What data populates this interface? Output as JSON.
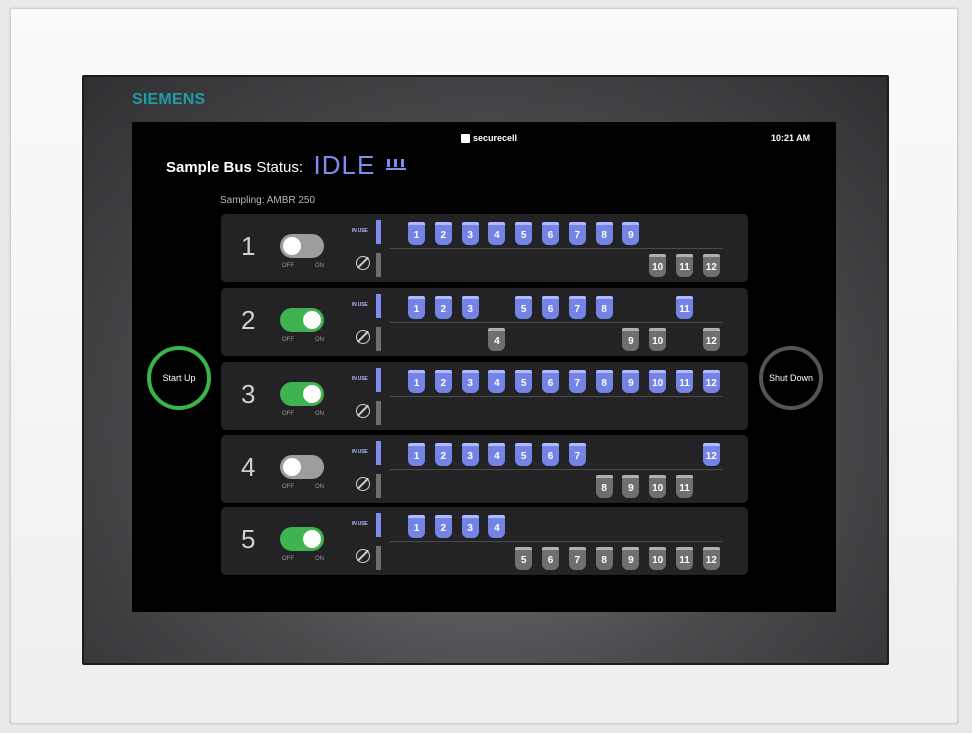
{
  "brand": "SIEMENS",
  "header": {
    "title_bold": "Sample Bus",
    "title_rest": "Status:",
    "status": "IDLE",
    "logo": "securecell",
    "time": "10:21 AM",
    "sampling": "Sampling: AMBR 250"
  },
  "buttons": {
    "start": "Start Up",
    "stop": "Shut Down"
  },
  "labels": {
    "in_use": "IN USE",
    "off": "OFF",
    "on": "ON"
  },
  "colors": {
    "in_use": "#7384e6",
    "idle": "#6f6f71",
    "toggle_on": "#3fb34f",
    "toggle_off": "#9d9d9f",
    "start_ring": "#38b449"
  },
  "rows": [
    {
      "number": "1",
      "on": false,
      "in_use": [
        1,
        2,
        3,
        4,
        5,
        6,
        7,
        8,
        9
      ],
      "idle": [
        10,
        11,
        12
      ]
    },
    {
      "number": "2",
      "on": true,
      "in_use": [
        1,
        2,
        3,
        5,
        6,
        7,
        8,
        11
      ],
      "idle": [
        4,
        9,
        10,
        12
      ]
    },
    {
      "number": "3",
      "on": true,
      "in_use": [
        1,
        2,
        3,
        4,
        5,
        6,
        7,
        8,
        9,
        10,
        11,
        12
      ],
      "idle": []
    },
    {
      "number": "4",
      "on": false,
      "in_use": [
        1,
        2,
        3,
        4,
        5,
        6,
        7,
        12
      ],
      "idle": [
        8,
        9,
        10,
        11
      ]
    },
    {
      "number": "5",
      "on": true,
      "in_use": [
        1,
        2,
        3,
        4
      ],
      "idle": [
        5,
        6,
        7,
        8,
        9,
        10,
        11,
        12
      ]
    }
  ]
}
